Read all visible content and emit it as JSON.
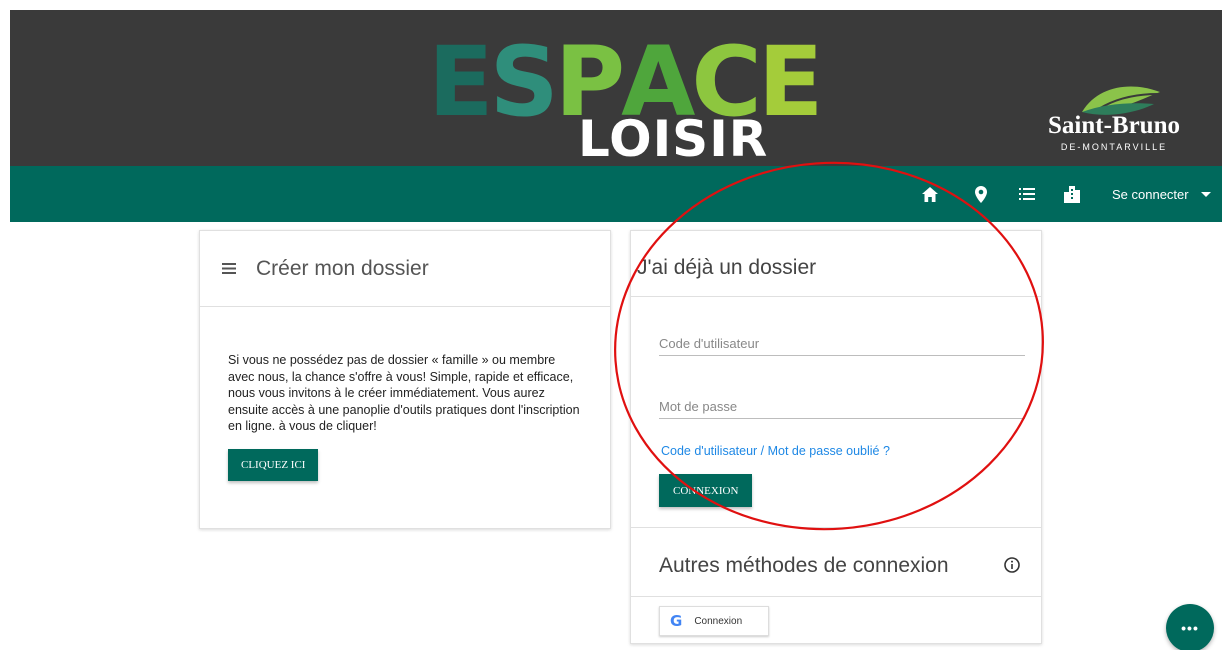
{
  "header": {
    "logo_top": "ESPACE",
    "logo_top_letters": [
      "E",
      "S",
      "P",
      "A",
      "C",
      "E"
    ],
    "logo_colors": [
      "#1b6b5e",
      "#2f8e7b",
      "#7ac143",
      "#4fa63c",
      "#8dc63f",
      "#a4cc3a"
    ],
    "logo_bottom": "LOISIR",
    "city_name": "Saint-Bruno",
    "city_sub": "DE-MONTARVILLE"
  },
  "nav": {
    "icons": [
      "home-icon",
      "map-marker-icon",
      "list-icon",
      "building-icon"
    ],
    "login_label": "Se connecter"
  },
  "create": {
    "title": "Créer mon dossier",
    "body": "Si vous ne possédez pas de dossier « famille » ou membre avec nous, la chance s'offre à vous! Simple, rapide et efficace, nous vous invitons à le créer immédiatement. Vous aurez ensuite accès à une panoplie d'outils pratiques dont l'inscription en ligne. à vous de cliquer!",
    "button": "CLIQUEZ ICI"
  },
  "login": {
    "title": "J'ai déjà un dossier",
    "username_placeholder": "Code d'utilisateur",
    "password_placeholder": "Mot de passe",
    "forgot_link": "Code d'utilisateur / Mot de passe oublié ?",
    "submit": "CONNEXION",
    "other_title": "Autres méthodes de connexion",
    "google_label": "Connexion"
  },
  "fab": {
    "label": "•••"
  },
  "colors": {
    "primary": "#00695c",
    "banner": "#3a3a3a",
    "link": "#1e88e5",
    "annotation": "#e01010"
  }
}
